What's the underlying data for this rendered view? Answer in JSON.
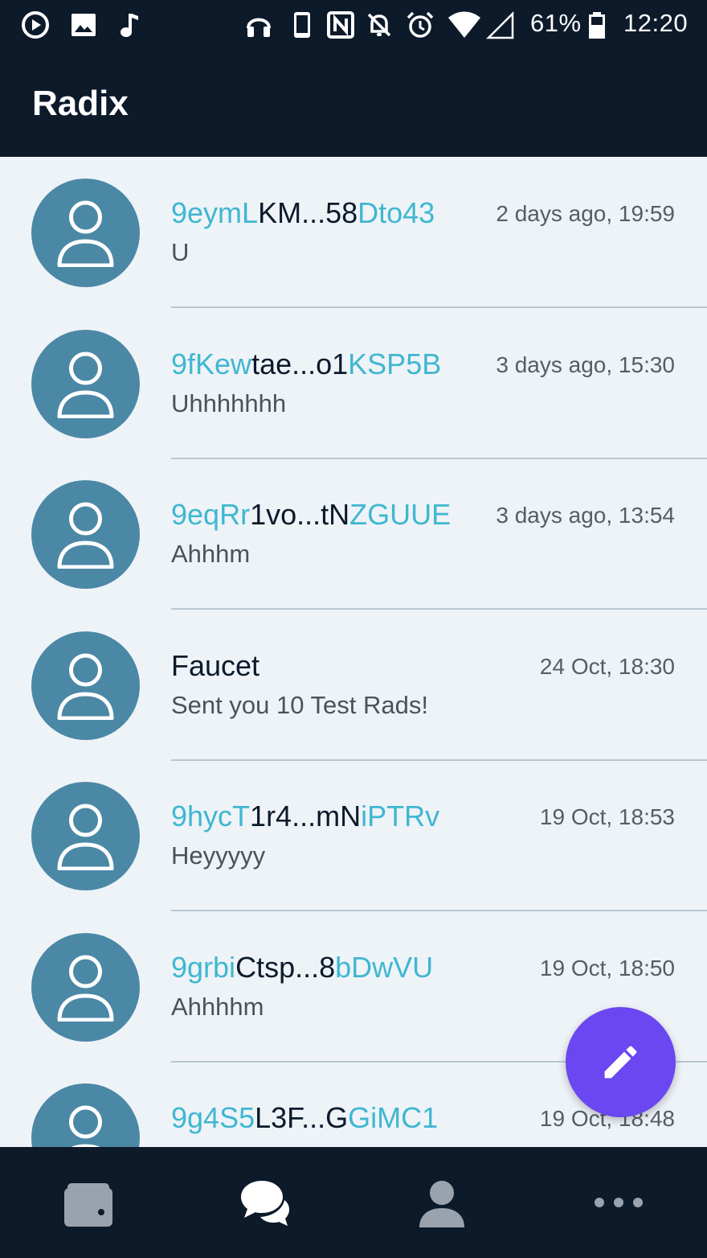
{
  "status_bar": {
    "battery": "61%",
    "time": "12:20",
    "icons": [
      "play-icon",
      "image-icon",
      "music-note-icon",
      "headphones-icon",
      "phone-icon",
      "nfc-icon",
      "notifications-off-icon",
      "alarm-icon",
      "wifi-icon",
      "signal-icon",
      "battery-icon"
    ]
  },
  "app_bar": {
    "title": "Radix"
  },
  "conversations": [
    {
      "name_parts": [
        {
          "t": "9eymL",
          "hl": true
        },
        {
          "t": "KM...58",
          "hl": false
        },
        {
          "t": "Dto43",
          "hl": true
        }
      ],
      "time": "2 days ago, 19:59",
      "message": "U"
    },
    {
      "name_parts": [
        {
          "t": "9fKew",
          "hl": true
        },
        {
          "t": "tae...o1",
          "hl": false
        },
        {
          "t": "KSP5B",
          "hl": true
        }
      ],
      "time": "3 days ago, 15:30",
      "message": "Uhhhhhhh"
    },
    {
      "name_parts": [
        {
          "t": "9eqRr",
          "hl": true
        },
        {
          "t": "1vo...tN",
          "hl": false
        },
        {
          "t": "ZGUUE",
          "hl": true
        }
      ],
      "time": "3 days ago, 13:54",
      "message": "Ahhhm"
    },
    {
      "name_parts": [
        {
          "t": "Faucet",
          "hl": false
        }
      ],
      "time": "24 Oct, 18:30",
      "message": "Sent you 10 Test Rads!"
    },
    {
      "name_parts": [
        {
          "t": "9hycT",
          "hl": true
        },
        {
          "t": "1r4...mN",
          "hl": false
        },
        {
          "t": "iPTRv",
          "hl": true
        }
      ],
      "time": "19 Oct, 18:53",
      "message": "Heyyyyy"
    },
    {
      "name_parts": [
        {
          "t": "9grbi",
          "hl": true
        },
        {
          "t": "Ctsp...8",
          "hl": false
        },
        {
          "t": "bDwVU",
          "hl": true
        }
      ],
      "time": "19 Oct, 18:50",
      "message": "Ahhhhm"
    },
    {
      "name_parts": [
        {
          "t": "9g4S5",
          "hl": true
        },
        {
          "t": "L3F...G",
          "hl": false
        },
        {
          "t": "GiMC1",
          "hl": true
        }
      ],
      "time": "19 Oct, 18:48",
      "message": ""
    }
  ],
  "fab": {
    "icon": "pencil-icon"
  },
  "bottom_nav": [
    {
      "icon": "wallet-icon"
    },
    {
      "icon": "chat-icon"
    },
    {
      "icon": "person-icon"
    },
    {
      "icon": "more-icon"
    }
  ],
  "colors": {
    "dark_bar": "#0c1a2a",
    "background": "#eef3f8",
    "avatar": "#4b88a6",
    "address_highlight": "#3fb7d0",
    "fab": "#6a47f0"
  }
}
